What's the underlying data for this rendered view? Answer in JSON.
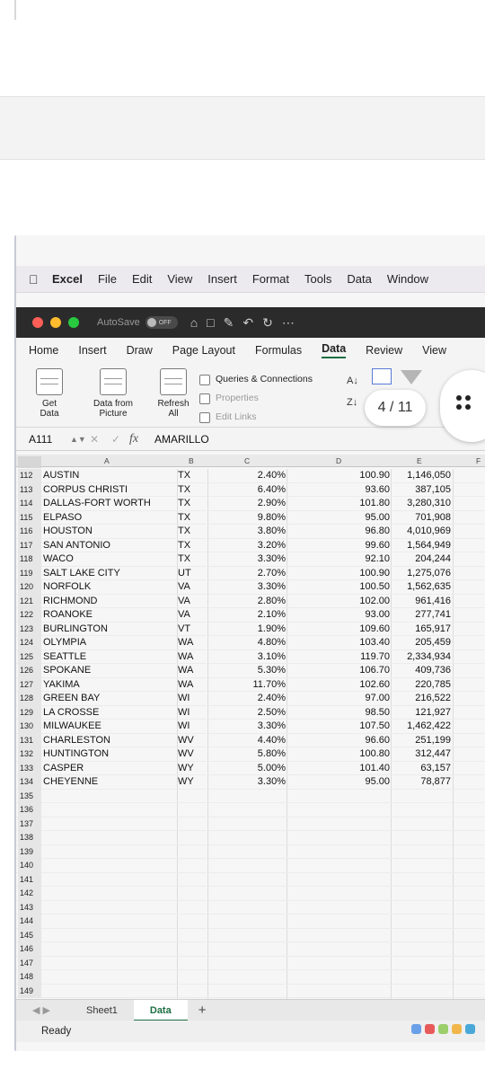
{
  "menubar": {
    "app": "Excel",
    "items": [
      "File",
      "Edit",
      "View",
      "Insert",
      "Format",
      "Tools",
      "Data",
      "Window"
    ]
  },
  "titlebar": {
    "autosave": "AutoSave",
    "toggle": "OFF"
  },
  "ribbon_tabs": [
    "Home",
    "Insert",
    "Draw",
    "Page Layout",
    "Formulas",
    "Data",
    "Review",
    "View"
  ],
  "ribbon": {
    "get_data": "Get\nData",
    "data_from_picture": "Data from\nPicture",
    "refresh_all": "Refresh\nAll",
    "queries": "Queries & Connections",
    "properties": "Properties",
    "edit_links": "Edit Links"
  },
  "viewer": {
    "page": "4 / 11"
  },
  "formula_bar": {
    "cell_ref": "A111",
    "content": "AMARILLO"
  },
  "columns": [
    "A",
    "B",
    "C",
    "D",
    "E",
    "F"
  ],
  "rows": [
    {
      "n": "112",
      "a": "AUSTIN",
      "b": "TX",
      "c": "2.40%",
      "d": "100.90",
      "e": "1,146,050"
    },
    {
      "n": "113",
      "a": "CORPUS CHRISTI",
      "b": "TX",
      "c": "6.40%",
      "d": "93.60",
      "e": "387,105"
    },
    {
      "n": "114",
      "a": "DALLAS-FORT WORTH",
      "b": "TX",
      "c": "2.90%",
      "d": "101.80",
      "e": "3,280,310"
    },
    {
      "n": "115",
      "a": "ELPASO",
      "b": "TX",
      "c": "9.80%",
      "d": "95.00",
      "e": "701,908"
    },
    {
      "n": "116",
      "a": "HOUSTON",
      "b": "TX",
      "c": "3.80%",
      "d": "96.80",
      "e": "4,010,969"
    },
    {
      "n": "117",
      "a": "SAN ANTONIO",
      "b": "TX",
      "c": "3.20%",
      "d": "99.60",
      "e": "1,564,949"
    },
    {
      "n": "118",
      "a": "WACO",
      "b": "TX",
      "c": "3.30%",
      "d": "92.10",
      "e": "204,244"
    },
    {
      "n": "119",
      "a": "SALT LAKE CITY",
      "b": "UT",
      "c": "2.70%",
      "d": "100.90",
      "e": "1,275,076"
    },
    {
      "n": "120",
      "a": "NORFOLK",
      "b": "VA",
      "c": "3.30%",
      "d": "100.50",
      "e": "1,562,635"
    },
    {
      "n": "121",
      "a": "RICHMOND",
      "b": "VA",
      "c": "2.80%",
      "d": "102.00",
      "e": "961,416"
    },
    {
      "n": "122",
      "a": "ROANOKE",
      "b": "VA",
      "c": "2.10%",
      "d": "93.00",
      "e": "277,741"
    },
    {
      "n": "123",
      "a": "BURLINGTON",
      "b": "VT",
      "c": "1.90%",
      "d": "109.60",
      "e": "165,917"
    },
    {
      "n": "124",
      "a": "OLYMPIA",
      "b": "WA",
      "c": "4.80%",
      "d": "103.40",
      "e": "205,459"
    },
    {
      "n": "125",
      "a": "SEATTLE",
      "b": "WA",
      "c": "3.10%",
      "d": "119.70",
      "e": "2,334,934"
    },
    {
      "n": "126",
      "a": "SPOKANE",
      "b": "WA",
      "c": "5.30%",
      "d": "106.70",
      "e": "409,736"
    },
    {
      "n": "127",
      "a": "YAKIMA",
      "b": "WA",
      "c": "11.70%",
      "d": "102.60",
      "e": "220,785"
    },
    {
      "n": "128",
      "a": "GREEN BAY",
      "b": "WI",
      "c": "2.40%",
      "d": "97.00",
      "e": "216,522"
    },
    {
      "n": "129",
      "a": "LA CROSSE",
      "b": "WI",
      "c": "2.50%",
      "d": "98.50",
      "e": "121,927"
    },
    {
      "n": "130",
      "a": "MILWAUKEE",
      "b": "WI",
      "c": "3.30%",
      "d": "107.50",
      "e": "1,462,422"
    },
    {
      "n": "131",
      "a": "CHARLESTON",
      "b": "WV",
      "c": "4.40%",
      "d": "96.60",
      "e": "251,199"
    },
    {
      "n": "132",
      "a": "HUNTINGTON",
      "b": "WV",
      "c": "5.80%",
      "d": "100.80",
      "e": "312,447"
    },
    {
      "n": "133",
      "a": "CASPER",
      "b": "WY",
      "c": "5.00%",
      "d": "101.40",
      "e": "63,157"
    },
    {
      "n": "134",
      "a": "CHEYENNE",
      "b": "WY",
      "c": "3.30%",
      "d": "95.00",
      "e": "78,877"
    },
    {
      "n": "135",
      "a": "",
      "b": "",
      "c": "",
      "d": "",
      "e": ""
    },
    {
      "n": "136",
      "a": "",
      "b": "",
      "c": "",
      "d": "",
      "e": ""
    },
    {
      "n": "137",
      "a": "",
      "b": "",
      "c": "",
      "d": "",
      "e": ""
    },
    {
      "n": "138",
      "a": "",
      "b": "",
      "c": "",
      "d": "",
      "e": ""
    },
    {
      "n": "139",
      "a": "",
      "b": "",
      "c": "",
      "d": "",
      "e": ""
    },
    {
      "n": "140",
      "a": "",
      "b": "",
      "c": "",
      "d": "",
      "e": ""
    },
    {
      "n": "141",
      "a": "",
      "b": "",
      "c": "",
      "d": "",
      "e": ""
    },
    {
      "n": "142",
      "a": "",
      "b": "",
      "c": "",
      "d": "",
      "e": ""
    },
    {
      "n": "143",
      "a": "",
      "b": "",
      "c": "",
      "d": "",
      "e": ""
    },
    {
      "n": "144",
      "a": "",
      "b": "",
      "c": "",
      "d": "",
      "e": ""
    },
    {
      "n": "145",
      "a": "",
      "b": "",
      "c": "",
      "d": "",
      "e": ""
    },
    {
      "n": "146",
      "a": "",
      "b": "",
      "c": "",
      "d": "",
      "e": ""
    },
    {
      "n": "147",
      "a": "",
      "b": "",
      "c": "",
      "d": "",
      "e": ""
    },
    {
      "n": "148",
      "a": "",
      "b": "",
      "c": "",
      "d": "",
      "e": ""
    },
    {
      "n": "149",
      "a": "",
      "b": "",
      "c": "",
      "d": "",
      "e": ""
    }
  ],
  "sheet_tabs": [
    "Sheet1",
    "Data"
  ],
  "active_sheet": "Data",
  "status": "Ready"
}
